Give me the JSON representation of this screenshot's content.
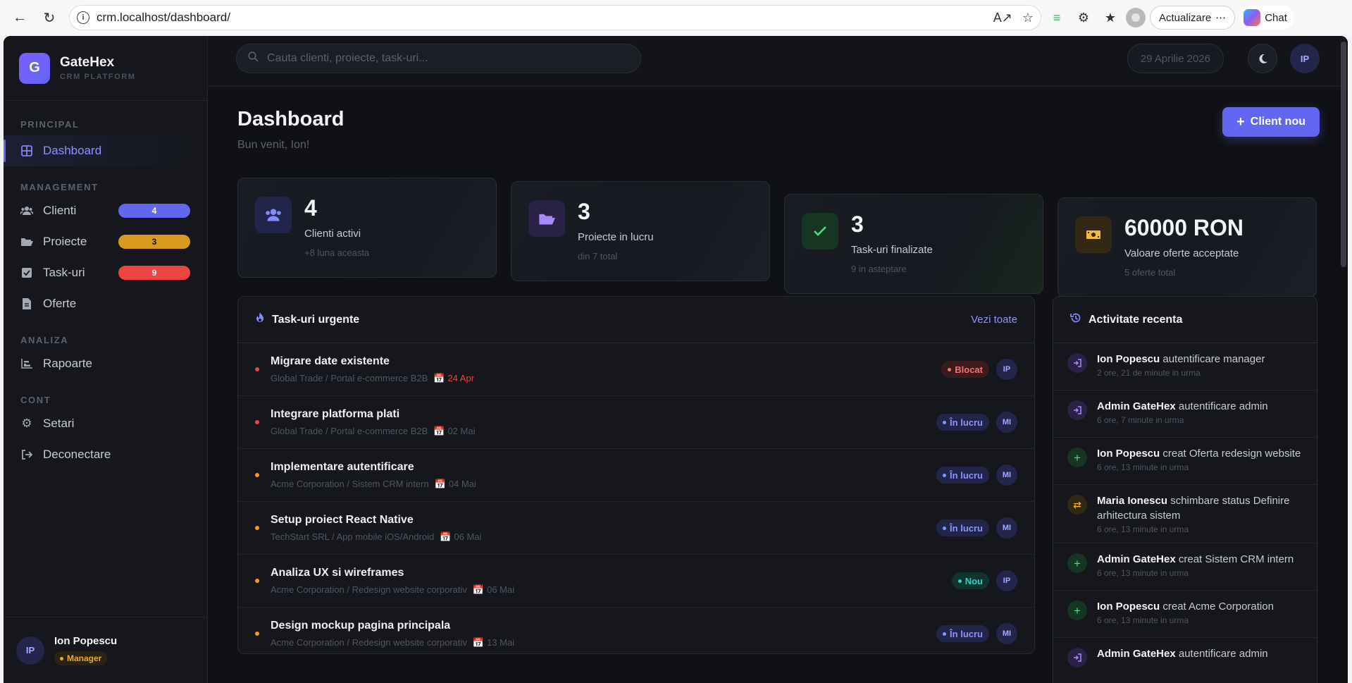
{
  "browser": {
    "url": "crm.localhost/dashboard/",
    "update_label": "Actualizare",
    "chat_label": "Chat"
  },
  "brand": {
    "logo_letter": "G",
    "name": "GateHex",
    "subtitle": "CRM PLATFORM"
  },
  "sidebar": {
    "sections": {
      "principal": "PRINCIPAL",
      "management": "MANAGEMENT",
      "analiza": "ANALIZA",
      "cont": "CONT"
    },
    "items": {
      "dashboard": "Dashboard",
      "clienti": "Clienti",
      "clienti_count": "4",
      "proiecte": "Proiecte",
      "proiecte_count": "3",
      "taskuri": "Task-uri",
      "taskuri_count": "9",
      "oferte": "Oferte",
      "rapoarte": "Rapoarte",
      "setari": "Setari",
      "deconectare": "Deconectare"
    },
    "user": {
      "initials": "IP",
      "name": "Ion Popescu",
      "role": "Manager"
    }
  },
  "topbar": {
    "search_placeholder": "Cauta clienti, proiecte, task-uri...",
    "date": "29 Aprilie 2026",
    "user_initials": "IP"
  },
  "page": {
    "title": "Dashboard",
    "subtitle": "Bun venit, Ion!",
    "new_client_label": "Client nou"
  },
  "stats": [
    {
      "value": "4",
      "label": "Clienti activi",
      "sub": "+8 luna aceasta",
      "accent": "#818cf8"
    },
    {
      "value": "3",
      "label": "Proiecte in lucru",
      "sub": "din 7 total",
      "accent": "#a78bfa"
    },
    {
      "value": "3",
      "label": "Task-uri finalizate",
      "sub": "9 in asteptare",
      "accent": "#4ade80"
    },
    {
      "value": "60000 RON",
      "label": "Valoare oferte acceptate",
      "sub": "5 oferte total",
      "accent": "#f5b942"
    }
  ],
  "tasks_panel": {
    "title": "Task-uri urgente",
    "link": "Vezi toate",
    "rows": [
      {
        "title": "Migrare date existente",
        "meta": "Global Trade / Portal e-commerce B2B",
        "date": "24 Apr",
        "status": "Blocat",
        "assignee": "IP",
        "priority_color": "#ef4444"
      },
      {
        "title": "Integrare platforma plati",
        "meta": "Global Trade / Portal e-commerce B2B",
        "date": "02 Mai",
        "status": "În lucru",
        "assignee": "MI",
        "priority_color": "#ef4444"
      },
      {
        "title": "Implementare autentificare",
        "meta": "Acme Corporation / Sistem CRM intern",
        "date": "04 Mai",
        "status": "În lucru",
        "assignee": "MI",
        "priority_color": "#f59e0b"
      },
      {
        "title": "Setup proiect React Native",
        "meta": "TechStart SRL / App mobile iOS/Android",
        "date": "06 Mai",
        "status": "În lucru",
        "assignee": "MI",
        "priority_color": "#f59e0b"
      },
      {
        "title": "Analiza UX si wireframes",
        "meta": "Acme Corporation / Redesign website corporativ",
        "date": "06 Mai",
        "status": "Nou",
        "assignee": "IP",
        "priority_color": "#f59e0b"
      },
      {
        "title": "Design mockup pagina principala",
        "meta": "Acme Corporation / Redesign website corporativ",
        "date": "13 Mai",
        "status": "În lucru",
        "assignee": "MI",
        "priority_color": "#f59e0b"
      }
    ]
  },
  "activity_panel": {
    "title": "Activitate recenta",
    "rows": [
      {
        "actor": "Ion Popescu",
        "action": "autentificare manager",
        "time": "2 ore, 21 de minute in urma",
        "icon": "login-icon"
      },
      {
        "actor": "Admin GateHex",
        "action": "autentificare admin",
        "time": "6 ore, 7 minute in urma",
        "icon": "login-icon"
      },
      {
        "actor": "Ion Popescu",
        "action": "creat Oferta redesign website",
        "time": "6 ore, 13 minute in urma",
        "icon": "plus-icon"
      },
      {
        "actor": "Maria Ionescu",
        "action": "schimbare status Definire arhitectura sistem",
        "time": "6 ore, 13 minute in urma",
        "icon": "swap-icon"
      },
      {
        "actor": "Admin GateHex",
        "action": "creat Sistem CRM intern",
        "time": "6 ore, 13 minute in urma",
        "icon": "plus-icon"
      },
      {
        "actor": "Ion Popescu",
        "action": "creat Acme Corporation",
        "time": "6 ore, 13 minute in urma",
        "icon": "plus-icon"
      },
      {
        "actor": "Admin GateHex",
        "action": "autentificare admin",
        "time": "",
        "icon": "login-icon"
      }
    ]
  }
}
